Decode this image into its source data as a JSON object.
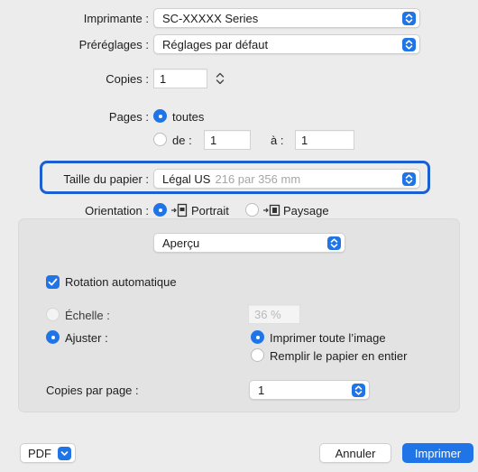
{
  "printer": {
    "label": "Imprimante :",
    "value": "SC-XXXXX Series"
  },
  "presets": {
    "label": "Préréglages :",
    "value": "Réglages par défaut"
  },
  "copies": {
    "label": "Copies :",
    "value": "1"
  },
  "pages": {
    "label": "Pages :",
    "all_label": "toutes",
    "from_label": "de :",
    "from_value": "1",
    "to_label": "à :",
    "to_value": "1"
  },
  "paper_size": {
    "label": "Taille du papier :",
    "value": "Légal US",
    "dimensions": "216 par 356 mm"
  },
  "orientation": {
    "label": "Orientation :",
    "portrait": "Portrait",
    "landscape": "Paysage"
  },
  "section_popup": {
    "value": "Aperçu"
  },
  "preview": {
    "auto_rotate_label": "Rotation automatique",
    "scale_label": "Échelle :",
    "scale_value": "36 %",
    "fit_label": "Ajuster :",
    "print_entire_label": "Imprimer toute l’image",
    "fill_paper_label": "Remplir le papier en entier",
    "copies_per_page_label": "Copies par page :",
    "copies_per_page_value": "1"
  },
  "footer": {
    "pdf_label": "PDF",
    "cancel_label": "Annuler",
    "print_label": "Imprimer"
  },
  "icons": {
    "popup": "chevron-updown-icon",
    "portrait": "portrait-orientation-icon",
    "landscape": "landscape-orientation-icon",
    "check": "checkmark-icon",
    "pdf_menu": "chevron-down-icon"
  },
  "colors": {
    "accent": "#1f75e8",
    "highlight_border": "#1b5fd0",
    "background": "#ececec"
  }
}
